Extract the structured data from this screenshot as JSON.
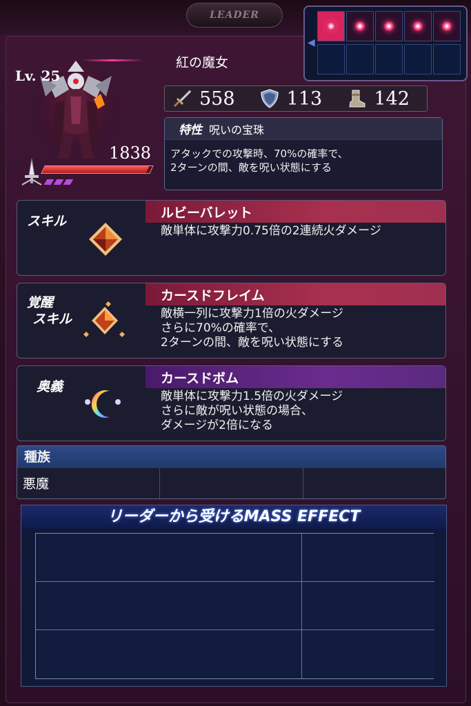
{
  "header": {
    "leader_label": "LEADER"
  },
  "party": {
    "top_row": [
      "active",
      "lit",
      "lit",
      "lit",
      "lit"
    ],
    "bottom_row": [
      "empty",
      "empty",
      "empty",
      "empty",
      "empty"
    ]
  },
  "character": {
    "name": "紅の魔女",
    "level": "Lv. 25",
    "hp": "1838",
    "hp_fraction": 0.97,
    "soul_marks": 3
  },
  "stats": {
    "attack": {
      "icon": "sword-icon",
      "value": "558"
    },
    "defense": {
      "icon": "shield-icon",
      "value": "113"
    },
    "speed": {
      "icon": "boot-icon",
      "value": "142"
    }
  },
  "trait": {
    "tag": "特性",
    "name": "呪いの宝珠",
    "desc_lines": [
      "アタックでの攻撃時、70%の確率で、",
      "2ターンの間、敵を呪い状態にする"
    ]
  },
  "skill": {
    "label": "スキル",
    "name": "ルビーバレット",
    "desc_lines": [
      "敵単体に攻撃力0.75倍の2連続火ダメージ"
    ]
  },
  "awaken_skill": {
    "label_lines": [
      "覚醒",
      "スキル"
    ],
    "name": "カースドフレイム",
    "desc_lines": [
      "敵横一列に攻撃力1倍の火ダメージ",
      "さらに70%の確率で、",
      "2ターンの間、敵を呪い状態にする"
    ]
  },
  "ultimate": {
    "label": "奥義",
    "name": "カースドボム",
    "desc_lines": [
      "敵単体に攻撃力1.5倍の火ダメージ",
      "さらに敵が呪い状態の場合、",
      "ダメージが2倍になる"
    ]
  },
  "race": {
    "header": "種族",
    "cells": [
      "悪魔",
      "",
      ""
    ]
  },
  "mass_effect": {
    "title": "リーダーから受けるMASS EFFECT",
    "rows": [
      [
        "",
        ""
      ],
      [
        "",
        ""
      ],
      [
        "",
        ""
      ]
    ]
  },
  "colors": {
    "skill_header": "#a8304e",
    "ultimate_header": "#6a2c8e",
    "race_header": "#2e4a86",
    "party_active": "#d8245c"
  }
}
